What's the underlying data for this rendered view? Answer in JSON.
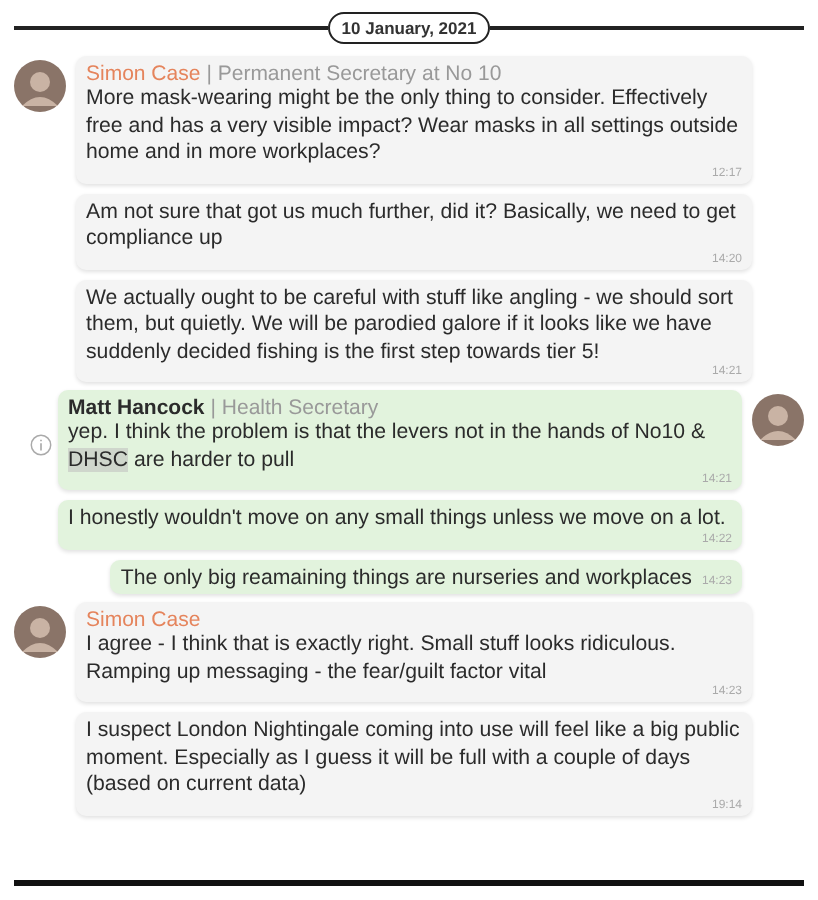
{
  "date_divider": "10 January, 2021",
  "groups": [
    {
      "kind": "incoming",
      "sender": {
        "name": "Simon Case",
        "role": "| Permanent Secretary at No 10"
      },
      "info_icon": false,
      "messages": [
        {
          "text": "More mask-wearing might be the only thing to consider. Effectively free and has a very visible impact? Wear masks in all settings outside home and in more workplaces?",
          "time": "12:17"
        },
        {
          "text": "Am not sure that got us much further, did it? Basically, we need to get compliance up",
          "time": "14:20"
        },
        {
          "text": "We actually ought to be careful with stuff like angling - we should sort them, but quietly. We will be parodied galore if it looks like we have suddenly decided fishing is the first step towards tier 5!",
          "time": "14:21"
        }
      ]
    },
    {
      "kind": "outgoing",
      "sender": {
        "name": "Matt Hancock",
        "role": "| Health Secretary"
      },
      "info_icon": true,
      "messages": [
        {
          "segments": [
            {
              "text": "yep. I think the problem is that the levers not in the hands of No10 & ",
              "highlighted": false
            },
            {
              "text": "DHSC",
              "highlighted": true
            },
            {
              "text": " are harder to pull",
              "highlighted": false
            }
          ],
          "time": "14:21"
        },
        {
          "text": "I honestly wouldn't move on any small things unless we move on a lot.",
          "time": "14:22"
        },
        {
          "text": "The only big reamaining things are nurseries and workplaces",
          "time": "14:23"
        }
      ]
    },
    {
      "kind": "incoming",
      "sender": {
        "name": "Simon Case"
      },
      "info_icon": false,
      "messages": [
        {
          "text": "I agree - I think that is exactly right. Small stuff looks ridiculous. Ramping up messaging - the fear/guilt factor vital",
          "time": "14:23"
        },
        {
          "text": "I suspect London Nightingale coming into use will feel like a big public moment. Especially as I guess it will be full with a couple of days (based on current data)",
          "time": "19:14"
        }
      ]
    }
  ]
}
